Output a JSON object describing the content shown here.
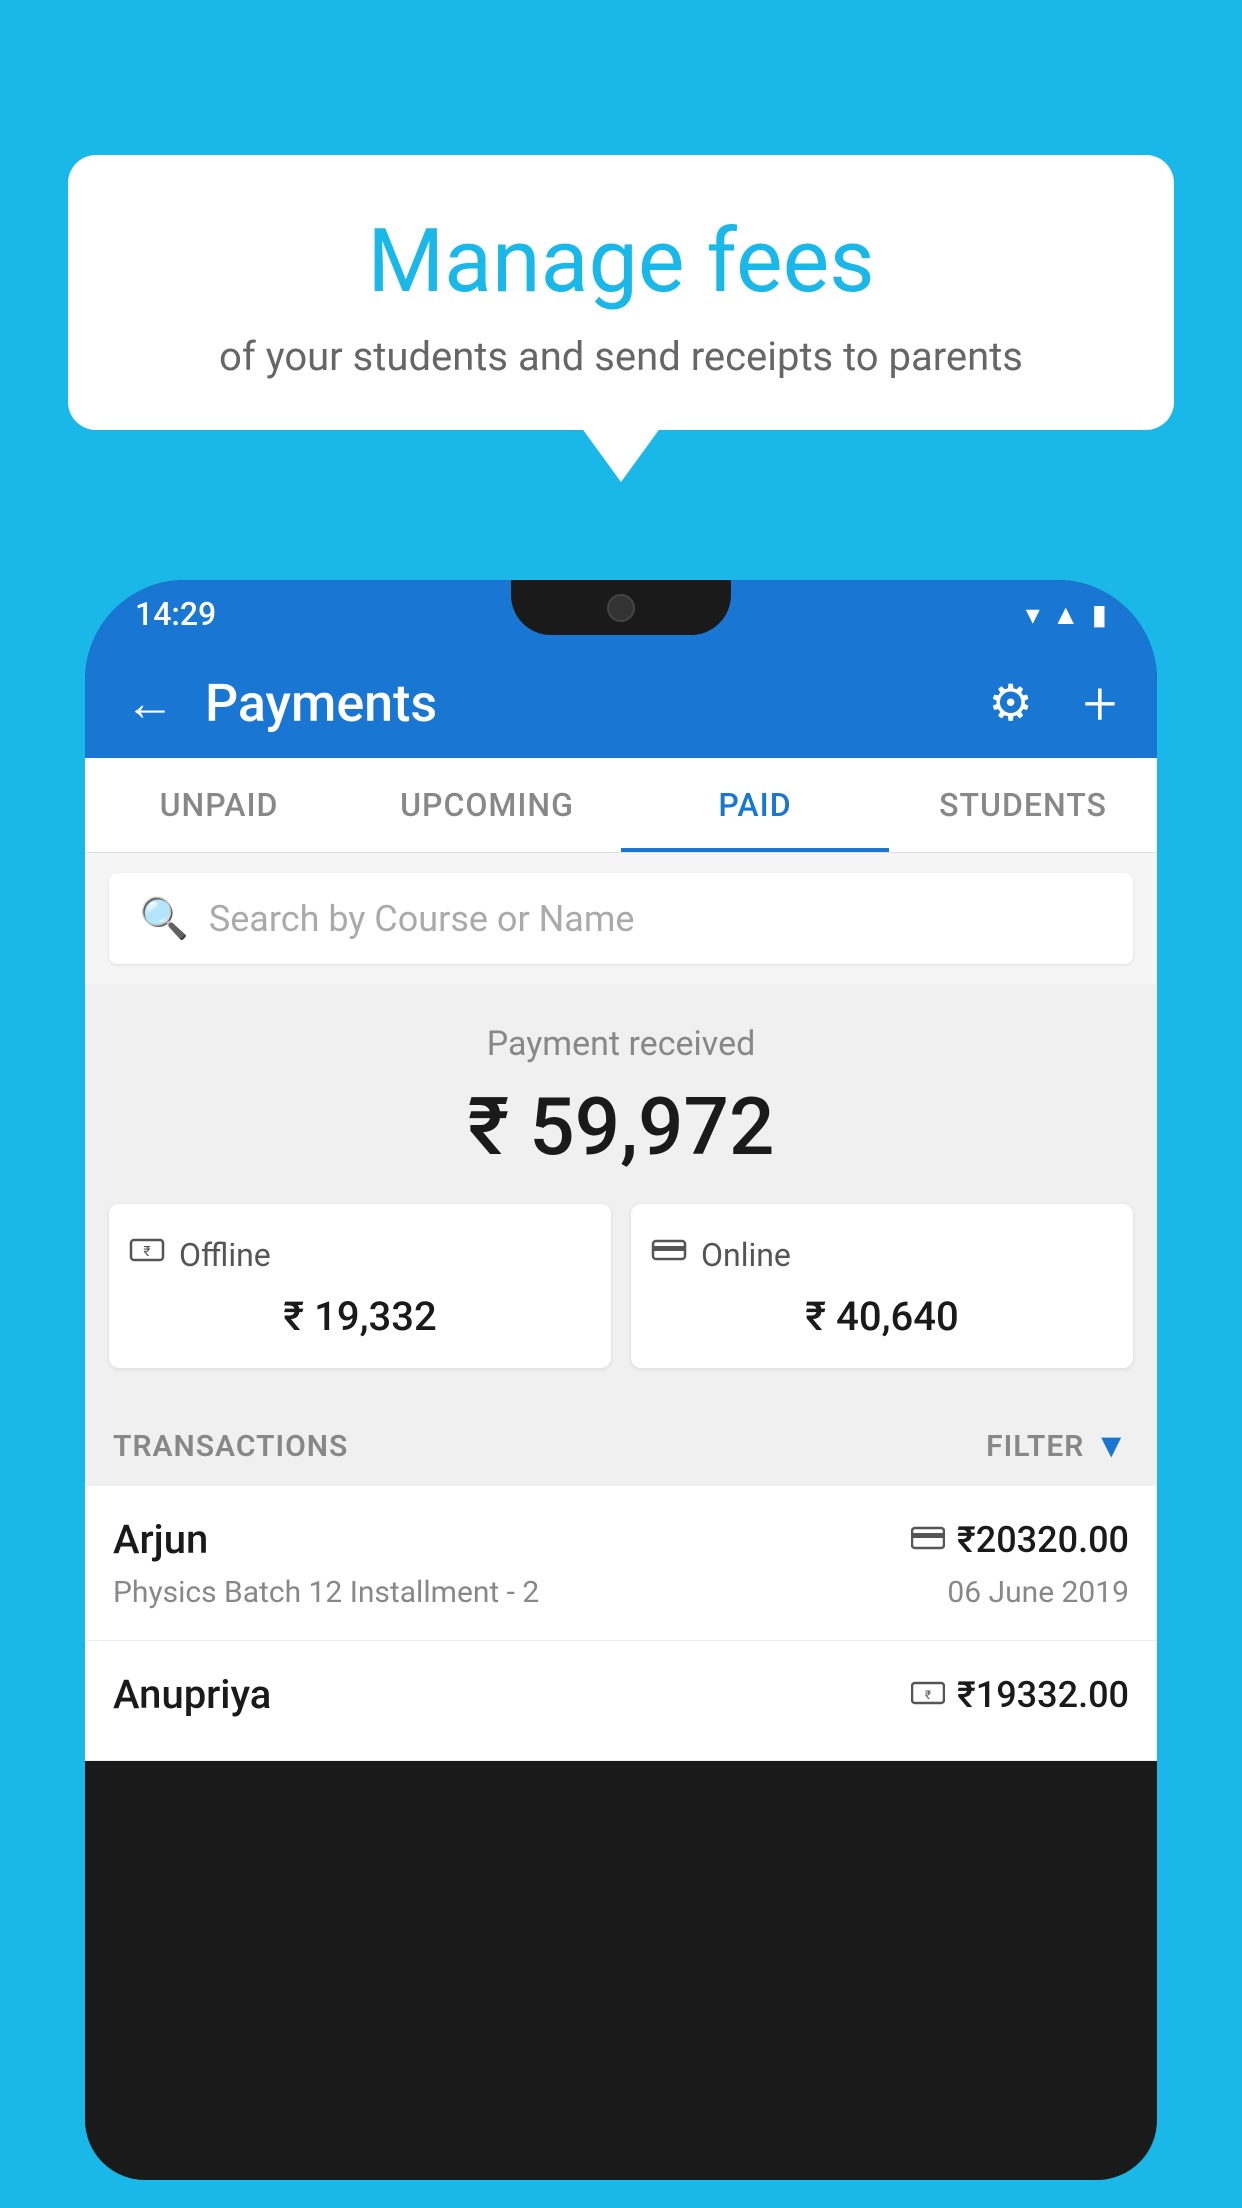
{
  "page": {
    "background_color": "#1ab8e8"
  },
  "speech_bubble": {
    "title": "Manage fees",
    "subtitle": "of your students and send receipts to parents"
  },
  "status_bar": {
    "time": "14:29",
    "wifi_icon": "wifi",
    "signal_icon": "signal",
    "battery_icon": "battery"
  },
  "app_bar": {
    "back_label": "←",
    "title": "Payments",
    "settings_icon": "gear",
    "add_icon": "+"
  },
  "tabs": [
    {
      "label": "UNPAID",
      "active": false
    },
    {
      "label": "UPCOMING",
      "active": false
    },
    {
      "label": "PAID",
      "active": true
    },
    {
      "label": "STUDENTS",
      "active": false
    }
  ],
  "search": {
    "placeholder": "Search by Course or Name"
  },
  "payment_summary": {
    "received_label": "Payment received",
    "total_amount": "₹ 59,972",
    "offline": {
      "label": "Offline",
      "amount": "₹ 19,332",
      "icon": "offline-payment"
    },
    "online": {
      "label": "Online",
      "amount": "₹ 40,640",
      "icon": "card-payment"
    }
  },
  "transactions": {
    "section_label": "TRANSACTIONS",
    "filter_label": "FILTER",
    "items": [
      {
        "name": "Arjun",
        "course": "Physics Batch 12 Installment - 2",
        "amount": "₹20320.00",
        "date": "06 June 2019",
        "payment_type": "online"
      },
      {
        "name": "Anupriya",
        "course": "",
        "amount": "₹19332.00",
        "date": "",
        "payment_type": "offline"
      }
    ]
  }
}
